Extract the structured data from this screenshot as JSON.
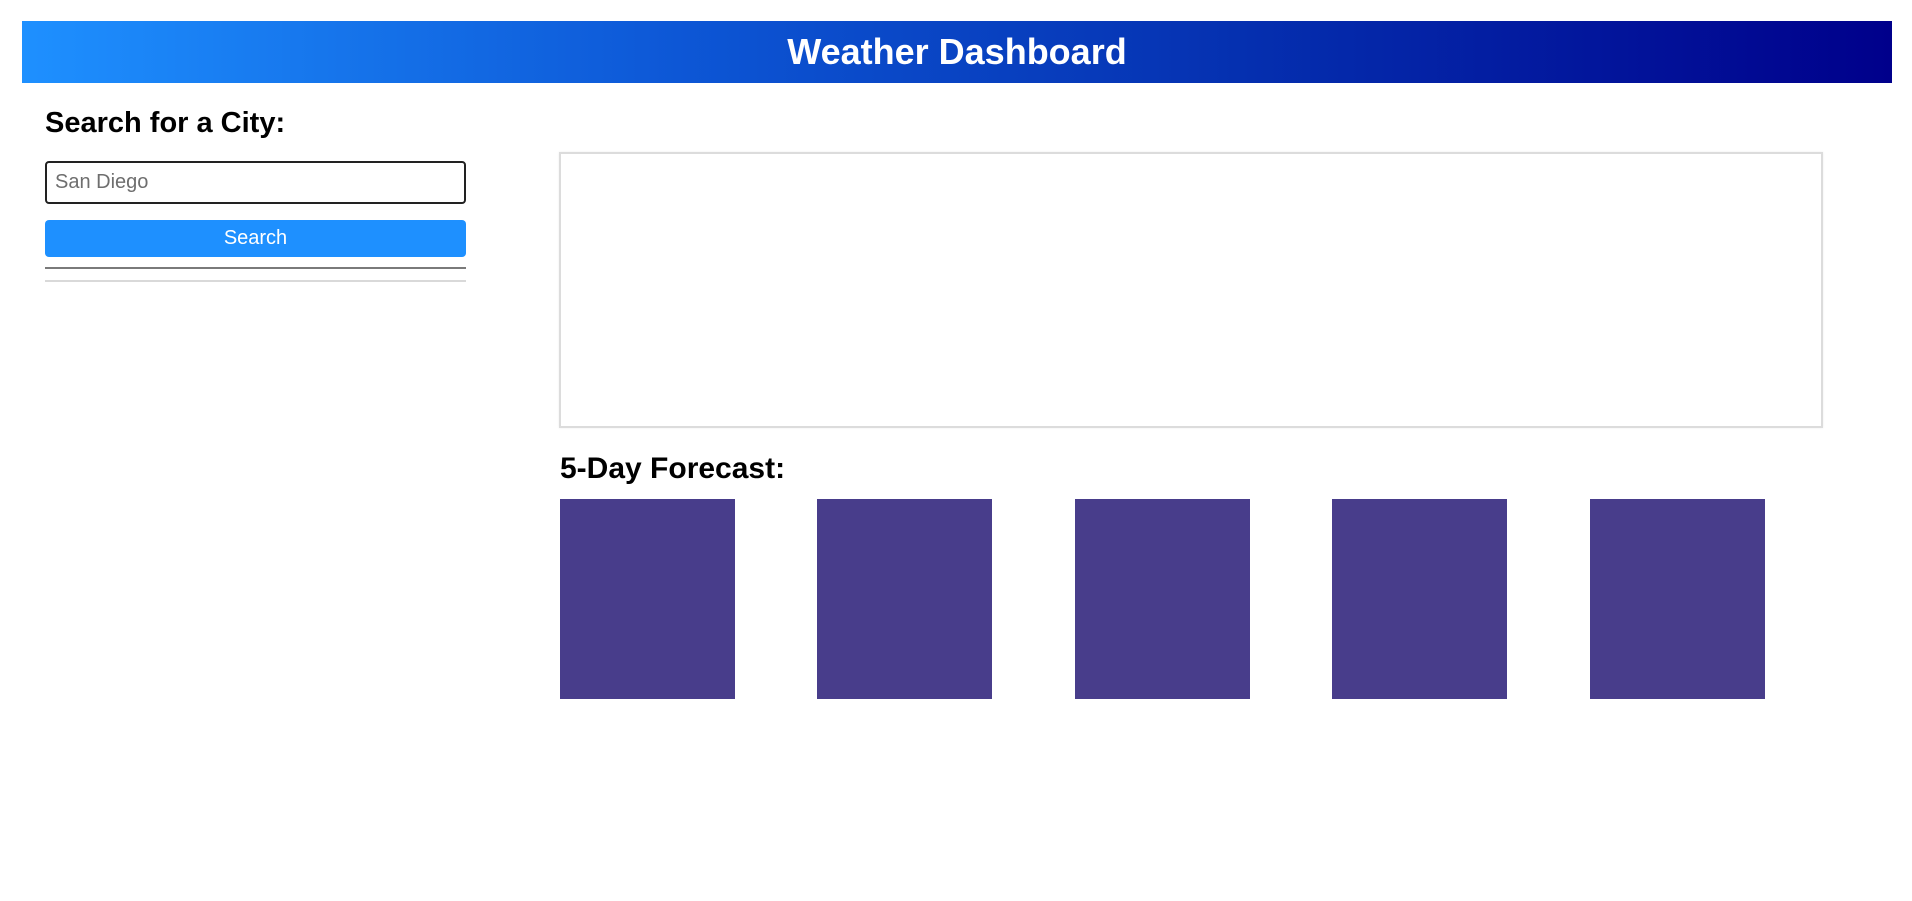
{
  "header": {
    "title": "Weather Dashboard"
  },
  "sidebar": {
    "heading": "Search for a City:",
    "search_input": {
      "value": "",
      "placeholder": "San Diego"
    },
    "search_button_label": "Search",
    "history": []
  },
  "main": {
    "current_weather": {},
    "forecast": {
      "heading": "5-Day Forecast:",
      "days": [
        {},
        {},
        {},
        {},
        {}
      ]
    }
  },
  "colors": {
    "header_gradient_start": "#1e90ff",
    "header_gradient_end": "#00008b",
    "button_bg": "#1e90ff",
    "forecast_card_bg": "#483d8b"
  }
}
